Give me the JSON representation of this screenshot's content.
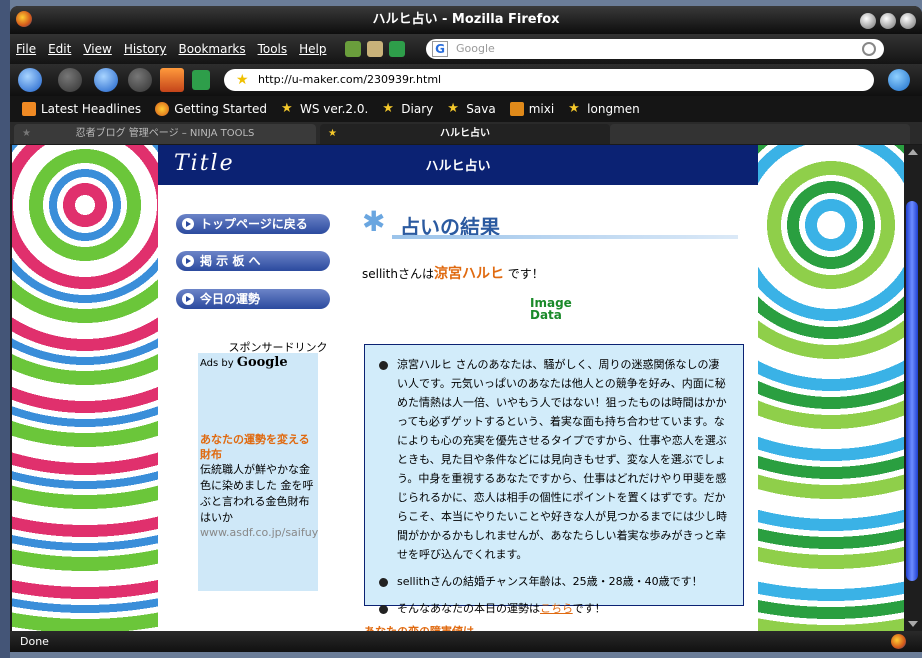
{
  "window": {
    "title": "ハルヒ占い - Mozilla Firefox"
  },
  "menu": [
    "File",
    "Edit",
    "View",
    "History",
    "Bookmarks",
    "Tools",
    "Help"
  ],
  "search": {
    "placeholder": "Google",
    "engine_icon": "google-icon"
  },
  "address": {
    "url": "http://u-maker.com/230939r.html"
  },
  "bookmarks": [
    {
      "label": "Latest Headlines",
      "icon": "rss-icon"
    },
    {
      "label": "Getting Started",
      "icon": "firefox-icon"
    },
    {
      "label": "WS ver.2.0.",
      "icon": "star-icon"
    },
    {
      "label": "Diary",
      "icon": "star-icon"
    },
    {
      "label": "Sava",
      "icon": "star-icon"
    },
    {
      "label": "mixi",
      "icon": "mixi-icon"
    },
    {
      "label": "longmen",
      "icon": "star-icon"
    }
  ],
  "tabs": [
    {
      "label": "忍者ブログ 管理ページ – NINJA TOOLS",
      "active": false
    },
    {
      "label": "ハルヒ占い",
      "active": true
    }
  ],
  "page": {
    "logo": "Title",
    "title": "ハルヒ占い",
    "nav": [
      "トップページに戻る",
      "掲 示 板 へ",
      "今日の運勢"
    ],
    "sponsor_label": "スポンサードリンク",
    "ads_by": "Ads by",
    "ads_brand": "Google",
    "ad_title": "あなたの運勢を変える財布",
    "ad_text": "伝統職人が鮮やかな金色に染めました 金を呼ぶと言われる金色財布はいか",
    "ad_url": "www.asdf.co.jp/saifuy",
    "result_heading": "占いの結果",
    "user_prefix": "sellithさんは",
    "user_result": "涼宮ハルヒ",
    "user_suffix": " です！",
    "image_placeholder_1": "Image",
    "image_placeholder_2": "Data",
    "result_items": [
      "涼宮ハルヒ さんのあなたは、騒がしく、周りの迷惑関係なしの凄い人です。元気いっぱいのあなたは他人との競争を好み、内面に秘めた情熱は人一倍、いやもう人ではない！狙ったものは時間はかかっても必ずゲットするという、着実な面も持ち合わせています。なによりも心の充実を優先させるタイプですから、仕事や恋人を選ぶときも、見た目や条件などには見向きもせず、変な人を選ぶでしょう。中身を重視するあなたですから、仕事はどれだけやり甲斐を感じられるかに、恋人は相手の個性にポイントを置くはずです。だからこそ、本当にやりたいことや好きな人が見つかるまでには少し時間がかかるかもしれませんが、あなたらしい着実な歩みがきっと幸せを呼び込んでくれます。",
      "sellithさんの結婚チャンス年齢は、25歳・28歳・40歳です！"
    ],
    "last_item_prefix": "そんなあなたの本日の運勢は",
    "last_item_link": "こちら",
    "last_item_suffix": "です！",
    "cutoff_text": "あなたの恋の障害値は"
  },
  "status": {
    "text": "Done"
  }
}
